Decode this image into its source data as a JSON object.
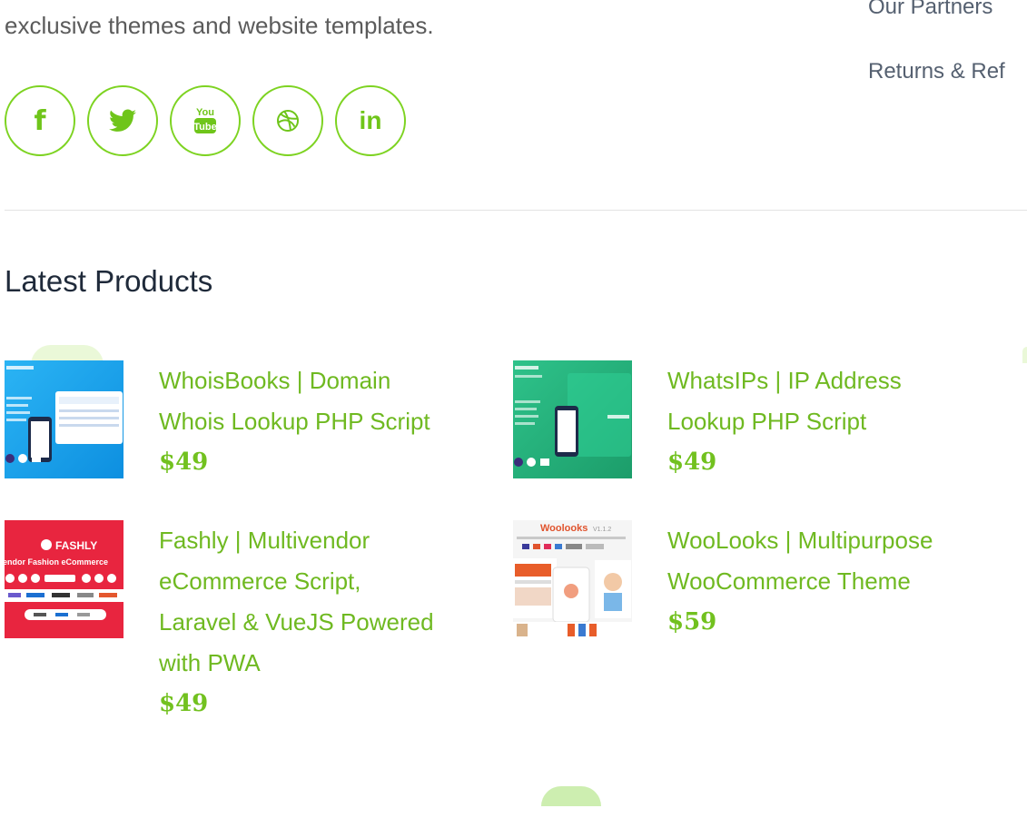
{
  "about": {
    "text": "exclusive themes and website templates."
  },
  "footer_links": {
    "partners": "Our Partners",
    "returns": "Returns & Ref"
  },
  "social": [
    {
      "name": "facebook",
      "label": "f"
    },
    {
      "name": "twitter",
      "label": ""
    },
    {
      "name": "youtube",
      "label": "You Tube"
    },
    {
      "name": "dribbble",
      "label": ""
    },
    {
      "name": "linkedin",
      "label": "in"
    }
  ],
  "section": {
    "title": "Latest Products"
  },
  "products": [
    {
      "name_line1": "WhoisBooks | Domain",
      "name_line2": "Whois Lookup PHP Script",
      "price": "$49",
      "thumb_color": "#1aa0ee"
    },
    {
      "name_line1": "WhatsIPs | IP Address",
      "name_line2": "Lookup PHP Script",
      "price": "$49",
      "thumb_color": "#23b07b"
    },
    {
      "name_line1": "Fashly | Multivendor",
      "name_line2": "eCommerce Script,",
      "name_line3": "Laravel & VueJS Powered",
      "name_line4": "with PWA",
      "price": "$49",
      "thumb_color": "#e8253f",
      "thumb_brand": "FASHLY",
      "thumb_tagline": "endor Fashion eCommerce"
    },
    {
      "name_line1": "WooLooks | Multipurpose",
      "name_line2": "WooCommerce Theme",
      "price": "$59",
      "thumb_color": "#f4f4f4",
      "thumb_brand": "Woolooks",
      "thumb_version": "V1.1.2"
    }
  ],
  "colors": {
    "accent": "#6fc51a",
    "link": "#6fb921",
    "price": "#72c11f"
  }
}
